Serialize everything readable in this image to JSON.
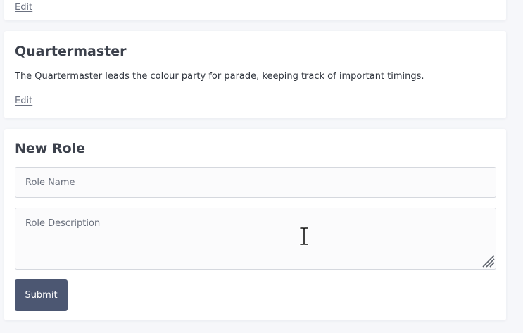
{
  "previous_role": {
    "edit_label": "Edit"
  },
  "quartermaster_role": {
    "title": "Quartermaster",
    "description": "The Quartermaster leads the colour party for parade, keeping track of important timings.",
    "edit_label": "Edit"
  },
  "new_role_form": {
    "heading": "New Role",
    "name_placeholder": "Role Name",
    "name_value": "",
    "description_placeholder": "Role Description",
    "description_value": "",
    "submit_label": "Submit"
  },
  "colors": {
    "submit_background": "#4c5772",
    "link_text": "#6b7180",
    "page_background": "#f6f7fa"
  },
  "icons": {
    "textarea_resize": "resize-grip-icon",
    "mouse_cursor": "text-cursor-icon"
  }
}
